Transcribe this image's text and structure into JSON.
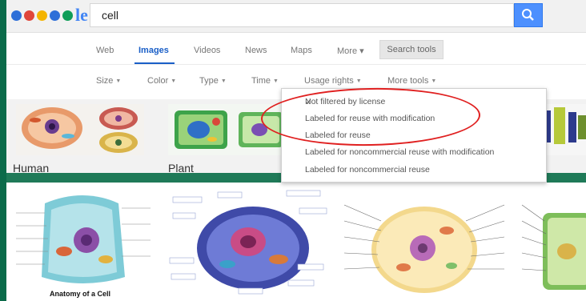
{
  "search": {
    "query": "cell"
  },
  "tabs": [
    {
      "label": "Web"
    },
    {
      "label": "Images"
    },
    {
      "label": "Videos"
    },
    {
      "label": "News"
    },
    {
      "label": "Maps"
    },
    {
      "label": "More ▾"
    }
  ],
  "search_tools_label": "Search tools",
  "tools": [
    {
      "label": "Size"
    },
    {
      "label": "Color"
    },
    {
      "label": "Type"
    },
    {
      "label": "Time"
    },
    {
      "label": "Usage rights"
    },
    {
      "label": "More tools"
    }
  ],
  "usage_menu": {
    "items": [
      {
        "label": "Not filtered by license",
        "selected": true
      },
      {
        "label": "Labeled for reuse with modification"
      },
      {
        "label": "Labeled for reuse"
      },
      {
        "label": "Labeled for noncommercial reuse with modification"
      },
      {
        "label": "Labeled for noncommercial reuse"
      }
    ]
  },
  "categories": [
    {
      "label": "Human"
    },
    {
      "label": "Plant"
    }
  ],
  "results": [
    {
      "caption": "Anatomy of a Cell"
    }
  ],
  "colors": {
    "accent": "#1a5fc7",
    "search_button": "#4d90fe",
    "highlight_circle": "#e02020",
    "frame": "#0b6b4a"
  }
}
